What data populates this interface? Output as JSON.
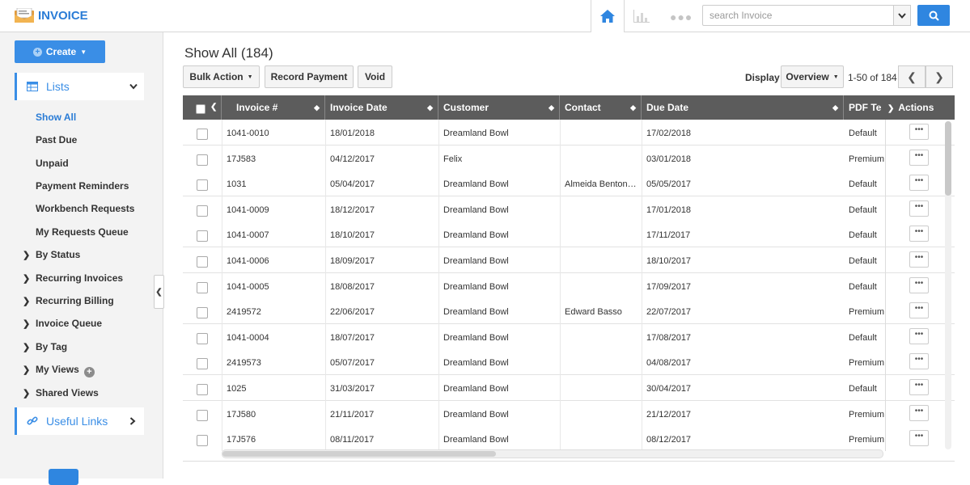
{
  "app": {
    "title": "INVOICE"
  },
  "topnav": {
    "search_placeholder": "search Invoice"
  },
  "sidebar": {
    "create_label": "Create",
    "lists_label": "Lists",
    "list_items": [
      "Show All",
      "Past Due",
      "Unpaid",
      "Payment Reminders",
      "Workbench Requests",
      "My Requests Queue"
    ],
    "groups": [
      "By Status",
      "Recurring Invoices",
      "Recurring Billing",
      "Invoice Queue",
      "By Tag",
      "My Views",
      "Shared Views"
    ],
    "useful_links_label": "Useful Links"
  },
  "main": {
    "title": "Show All (184)",
    "toolbar": {
      "bulk_action": "Bulk Action",
      "record_payment": "Record Payment",
      "void": "Void"
    },
    "display_label": "Display",
    "display_value": "Overview",
    "range": "1-50 of 184"
  },
  "table": {
    "columns": [
      "Invoice #",
      "Invoice Date",
      "Customer",
      "Contact",
      "Due Date",
      "PDF Te",
      "Actions"
    ],
    "rows": [
      {
        "invoice": "1041-0010",
        "date": "18/01/2018",
        "customer": "Dreamland Bowl",
        "contact": "",
        "due": "17/02/2018",
        "pdf": "Default"
      },
      {
        "invoice": "17J583",
        "date": "04/12/2017",
        "customer": "Felix",
        "contact": "",
        "due": "03/01/2018",
        "pdf": "Premium"
      },
      {
        "invoice": "1031",
        "date": "05/04/2017",
        "customer": "Dreamland Bowl",
        "contact": "Almeida Benton…",
        "due": "05/05/2017",
        "pdf": "Default"
      },
      {
        "invoice": "1041-0009",
        "date": "18/12/2017",
        "customer": "Dreamland Bowl",
        "contact": "",
        "due": "17/01/2018",
        "pdf": "Default"
      },
      {
        "invoice": "1041-0007",
        "date": "18/10/2017",
        "customer": "Dreamland Bowl",
        "contact": "",
        "due": "17/11/2017",
        "pdf": "Default"
      },
      {
        "invoice": "1041-0006",
        "date": "18/09/2017",
        "customer": "Dreamland Bowl",
        "contact": "",
        "due": "18/10/2017",
        "pdf": "Default"
      },
      {
        "invoice": "1041-0005",
        "date": "18/08/2017",
        "customer": "Dreamland Bowl",
        "contact": "",
        "due": "17/09/2017",
        "pdf": "Default"
      },
      {
        "invoice": "2419572",
        "date": "22/06/2017",
        "customer": "Dreamland Bowl",
        "contact": "Edward Basso",
        "due": "22/07/2017",
        "pdf": "Premium"
      },
      {
        "invoice": "1041-0004",
        "date": "18/07/2017",
        "customer": "Dreamland Bowl",
        "contact": "",
        "due": "17/08/2017",
        "pdf": "Default"
      },
      {
        "invoice": "2419573",
        "date": "05/07/2017",
        "customer": "Dreamland Bowl",
        "contact": "",
        "due": "04/08/2017",
        "pdf": "Premium"
      },
      {
        "invoice": "1025",
        "date": "31/03/2017",
        "customer": "Dreamland Bowl",
        "contact": "",
        "due": "30/04/2017",
        "pdf": "Default"
      },
      {
        "invoice": "17J580",
        "date": "21/11/2017",
        "customer": "Dreamland Bowl",
        "contact": "",
        "due": "21/12/2017",
        "pdf": "Premium"
      },
      {
        "invoice": "17J576",
        "date": "08/11/2017",
        "customer": "Dreamland Bowl",
        "contact": "",
        "due": "08/12/2017",
        "pdf": "Premium"
      }
    ]
  },
  "colors": {
    "accent": "#2f86e0",
    "header_bg": "#5c5c5c",
    "sidebar_bg": "#f3f3f3"
  }
}
